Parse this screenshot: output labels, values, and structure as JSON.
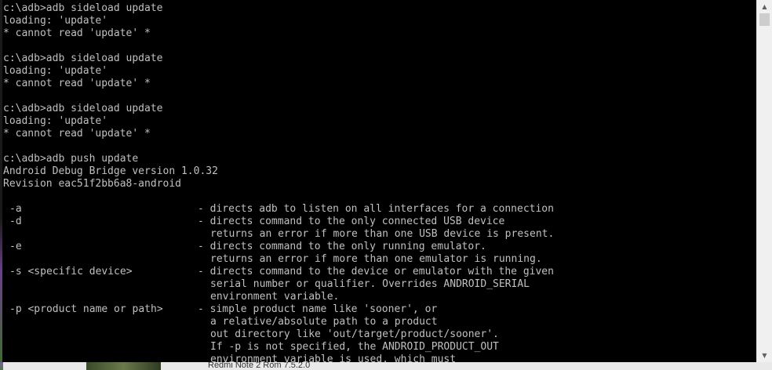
{
  "console": {
    "lines": [
      "c:\\adb>adb sideload update",
      "loading: 'update'",
      "* cannot read 'update' *",
      "",
      "c:\\adb>adb sideload update",
      "loading: 'update'",
      "* cannot read 'update' *",
      "",
      "c:\\adb>adb sideload update",
      "loading: 'update'",
      "* cannot read 'update' *",
      "",
      "c:\\adb>adb push update",
      "Android Debug Bridge version 1.0.32",
      "Revision eac51f2bb6a8-android",
      ""
    ],
    "options": [
      {
        "name": "-a",
        "desc": [
          "- directs adb to listen on all interfaces for a connection"
        ]
      },
      {
        "name": "-d",
        "desc": [
          "- directs command to the only connected USB device",
          "returns an error if more than one USB device is present."
        ]
      },
      {
        "name": "-e",
        "desc": [
          "- directs command to the only running emulator.",
          "returns an error if more than one emulator is running."
        ]
      },
      {
        "name": "-s <specific device>",
        "desc": [
          "- directs command to the device or emulator with the given",
          "serial number or qualifier. Overrides ANDROID_SERIAL",
          "environment variable."
        ]
      },
      {
        "name": "-p <product name or path>",
        "desc": [
          "- simple product name like 'sooner', or",
          "a relative/absolute path to a product",
          "out directory like 'out/target/product/sooner'.",
          "If -p is not specified, the ANDROID_PRODUCT_OUT",
          "environment variable is used, which must"
        ]
      }
    ]
  },
  "scrollbar": {
    "up_icon": "triangle-up-icon",
    "down_icon": "triangle-down-icon"
  },
  "desktop": {
    "label": "Redmi Note 2 Rom 7.5.2.0"
  }
}
